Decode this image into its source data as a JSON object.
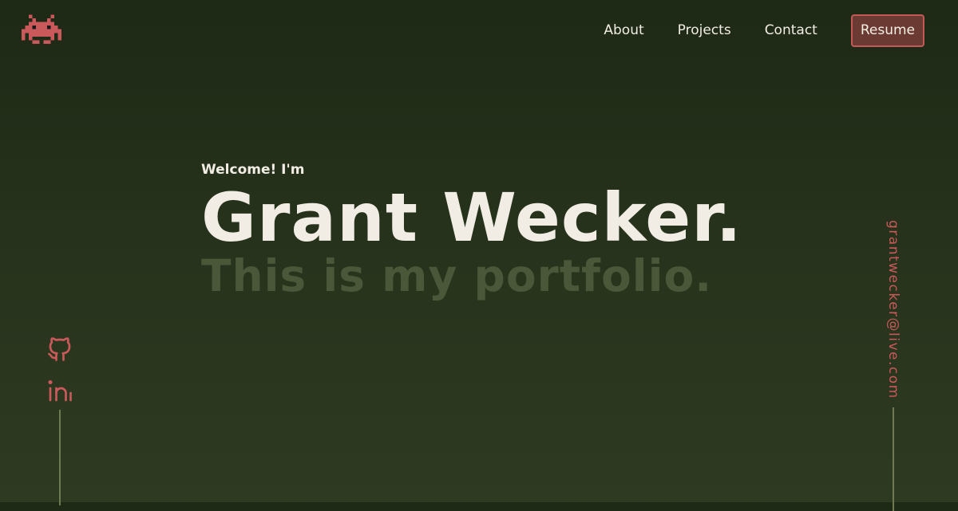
{
  "logo": {
    "icon": "space-invader-icon",
    "color": "#c9595a"
  },
  "nav": {
    "links": [
      "About",
      "Projects",
      "Contact"
    ],
    "resume_label": "Resume"
  },
  "hero": {
    "greeting": "Welcome! I'm",
    "name": "Grant Wecker.",
    "tagline": "This is my portfolio."
  },
  "social": {
    "icons": [
      "github-icon",
      "linkedin-icon"
    ]
  },
  "email": {
    "address": "grantwecker@live.com"
  },
  "colors": {
    "accent": "#c9595a",
    "background_top": "#1e2916",
    "background_bottom": "#2e3a21",
    "text": "#f1ede4",
    "tagline": "#4a5738",
    "resume_bg": "#6b3a33"
  }
}
